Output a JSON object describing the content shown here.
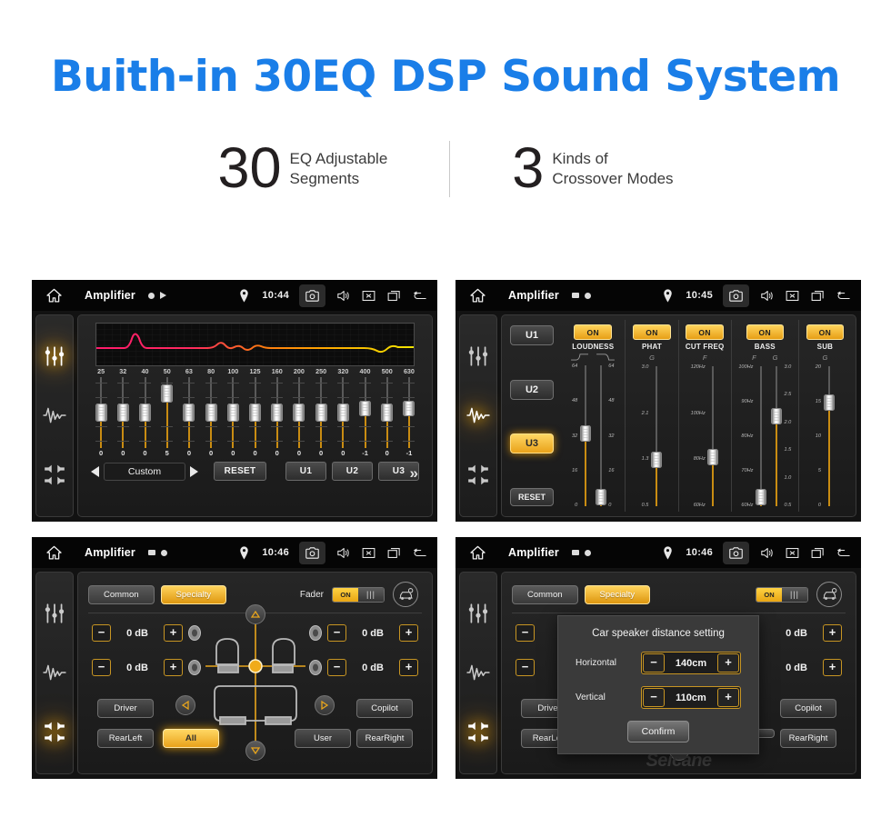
{
  "hero": {
    "title": "Buith-in 30EQ DSP Sound System",
    "stats": [
      {
        "number": "30",
        "line1": "EQ Adjustable",
        "line2": "Segments"
      },
      {
        "number": "3",
        "line1": "Kinds of",
        "line2": "Crossover Modes"
      }
    ]
  },
  "panels": {
    "eq": {
      "status": {
        "title": "Amplifier",
        "time": "10:44"
      },
      "graph_label": "eq-response-curve",
      "frequencies": [
        "25",
        "32",
        "40",
        "50",
        "63",
        "80",
        "100",
        "125",
        "160",
        "200",
        "250",
        "320",
        "400",
        "500",
        "630"
      ],
      "values": [
        "0",
        "0",
        "0",
        "5",
        "0",
        "0",
        "0",
        "0",
        "0",
        "0",
        "0",
        "0",
        "-1",
        "0",
        "-1"
      ],
      "next_label": "»",
      "preset": "Custom",
      "reset_label": "RESET",
      "user_presets": [
        "U1",
        "U2",
        "U3"
      ]
    },
    "crossover": {
      "status": {
        "title": "Amplifier",
        "time": "10:45"
      },
      "presets": [
        "U1",
        "U2",
        "U3"
      ],
      "active_preset": "U3",
      "reset_label": "RESET",
      "columns": [
        {
          "name": "LOUDNESS",
          "on_label": "ON",
          "subs": [
            "",
            ""
          ],
          "sliders": [
            {
              "scale": [
                "64",
                "48",
                "32",
                "16",
                "0"
              ],
              "value_pct": 50
            },
            {
              "scale": [
                "64",
                "48",
                "32",
                "16",
                "0"
              ],
              "value_pct": 8
            }
          ]
        },
        {
          "name": "PHAT",
          "on_label": "ON",
          "subs": [
            "G"
          ],
          "sliders": [
            {
              "scale": [
                "3.0",
                "2.1",
                "1.3",
                "0.5"
              ],
              "value_pct": 32
            }
          ]
        },
        {
          "name": "CUT FREQ",
          "on_label": "ON",
          "subs": [
            "F"
          ],
          "sliders": [
            {
              "scale": [
                "120Hz",
                "100Hz",
                "80Hz",
                "60Hz"
              ],
              "value_pct": 34
            }
          ]
        },
        {
          "name": "BASS",
          "on_label": "ON",
          "subs": [
            "F",
            "G"
          ],
          "sliders": [
            {
              "scale": [
                "100Hz",
                "90Hz",
                "80Hz",
                "70Hz",
                "60Hz"
              ],
              "value_pct": 8
            },
            {
              "scale": [
                "3.0",
                "2.5",
                "2.0",
                "1.5",
                "1.0",
                "0.5"
              ],
              "value_pct": 62
            }
          ]
        },
        {
          "name": "SUB",
          "on_label": "ON",
          "subs": [
            "G"
          ],
          "sliders": [
            {
              "scale": [
                "20",
                "15",
                "10",
                "5",
                "0"
              ],
              "value_pct": 72
            }
          ]
        }
      ]
    },
    "fader": {
      "status": {
        "title": "Amplifier",
        "time": "10:46"
      },
      "tabs": [
        "Common",
        "Specialty"
      ],
      "active_tab": "Specialty",
      "fader_label": "Fader",
      "fader_state": "ON",
      "car_icon": "car-settings-icon",
      "db_values": [
        "0 dB",
        "0 dB",
        "0 dB",
        "0 dB"
      ],
      "buttons": {
        "driver": "Driver",
        "copilot": "Copilot",
        "rear_left": "RearLeft",
        "rear_right": "RearRight",
        "user": "User",
        "all": "All"
      },
      "active_button": "All"
    },
    "dialog": {
      "status": {
        "title": "Amplifier",
        "time": "10:46"
      },
      "tabs": [
        "Common",
        "Specialty"
      ],
      "active_tab": "Specialty",
      "fader_state": "ON",
      "title": "Car speaker distance setting",
      "rows": [
        {
          "label": "Horizontal",
          "value": "140cm"
        },
        {
          "label": "Vertical",
          "value": "110cm"
        }
      ],
      "confirm_label": "Confirm",
      "buttons": {
        "driver": "Driver",
        "copilot": "Copilot",
        "rear_left": "RearLeft",
        "rear_right": "RearRight"
      },
      "watermark": "Seicane"
    }
  },
  "colors": {
    "title_blue": "#1a7ee8",
    "accent_amber": "#e9a21a",
    "panel_black": "#121212"
  }
}
